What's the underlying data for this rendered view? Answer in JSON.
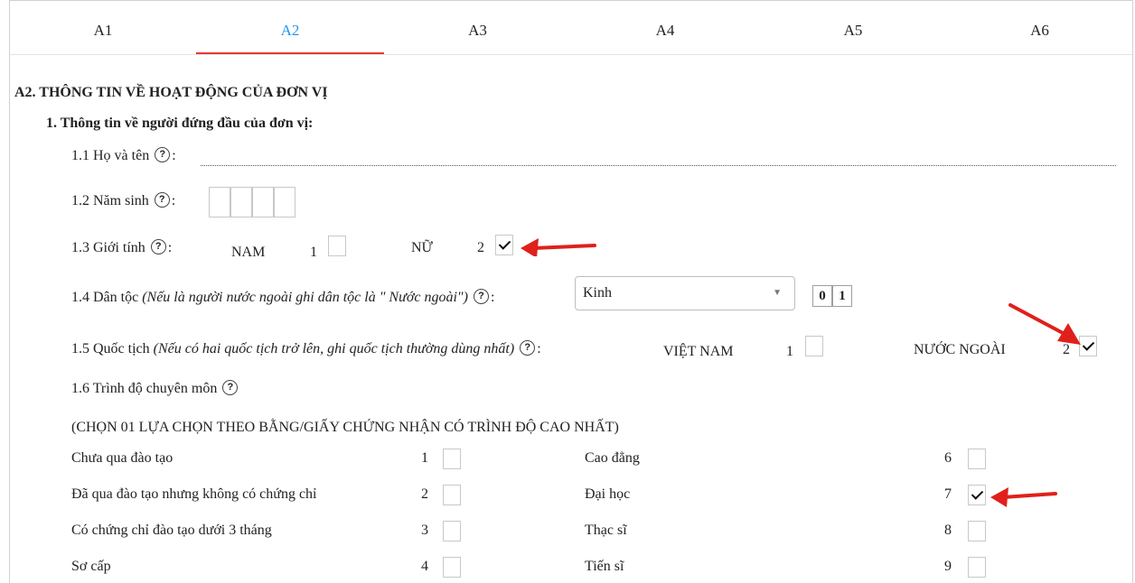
{
  "tabs": [
    "A1",
    "A2",
    "A3",
    "A4",
    "A5",
    "A6"
  ],
  "section_title": "A2. THÔNG TIN VỀ HOẠT ĐỘNG CỦA ĐƠN VỊ",
  "subsection_title": "1. Thông tin về người đứng đầu của đơn vị:",
  "help_glyph": "?",
  "q11": {
    "label": "1.1 Họ và tên",
    "suffix": ":"
  },
  "q12": {
    "label": "1.2 Năm sinh",
    "suffix": ":"
  },
  "q13": {
    "label": "1.3 Giới tính",
    "suffix": ":",
    "opt1_label": "NAM",
    "opt1_code": "1",
    "opt2_label": "NỮ",
    "opt2_code": "2"
  },
  "q14": {
    "label": "1.4 Dân tộc",
    "note": "(Nếu là người nước ngoài ghi dân tộc là \" Nước ngoài\")",
    "suffix": ":",
    "select_value": "Kinh",
    "caret": "▼",
    "code_digits": [
      "0",
      "1"
    ]
  },
  "q15": {
    "label": "1.5 Quốc tịch",
    "note": "(Nếu có hai quốc tịch trở lên, ghi quốc tịch thường dùng nhất)",
    "suffix": ":",
    "opt1_label": "VIỆT NAM",
    "opt1_code": "1",
    "opt2_label": "NƯỚC NGOÀI",
    "opt2_code": "2"
  },
  "q16": {
    "label": "1.6 Trình độ chuyên môn",
    "instruction": "(CHỌN 01 LỰA CHỌN THEO BẰNG/GIẤY CHỨNG NHẬN CÓ TRÌNH ĐỘ CAO NHẤT)",
    "options": [
      {
        "label": "Chưa qua đào tạo",
        "code": "1"
      },
      {
        "label": "Đã qua đào tạo nhưng không có chứng chỉ",
        "code": "2"
      },
      {
        "label": "Có chứng chỉ đào tạo dưới 3 tháng",
        "code": "3"
      },
      {
        "label": "Sơ cấp",
        "code": "4"
      },
      {
        "label": "Cao đẳng",
        "code": "6"
      },
      {
        "label": "Đại học",
        "code": "7"
      },
      {
        "label": "Thạc sĩ",
        "code": "8"
      },
      {
        "label": "Tiến sĩ",
        "code": "9"
      }
    ]
  },
  "checked": {
    "gender": "2",
    "nationality": "2",
    "education": "7"
  },
  "colors": {
    "active_tab": "#2196f3",
    "tab_underline": "#e53935",
    "arrow": "#e0201b"
  }
}
